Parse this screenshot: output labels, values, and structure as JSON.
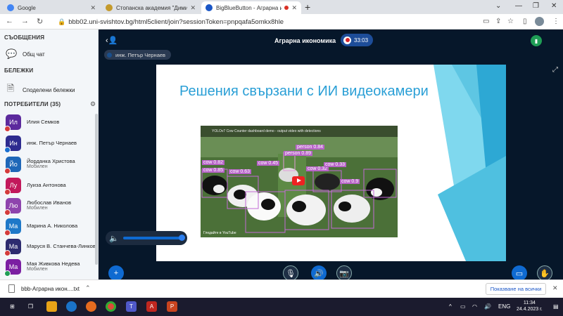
{
  "browser": {
    "tabs": [
      {
        "title": "Google",
        "active": false,
        "favicon_color": "#4285f4"
      },
      {
        "title": "Стопанска академия \"Димитър",
        "active": false,
        "favicon_color": "#c49a2c"
      },
      {
        "title": "BigBlueButton - Аграрна ик",
        "active": true,
        "favicon_color": "#1a56c6"
      }
    ],
    "new_tab": "+",
    "url": "bbb02.uni-svishtov.bg/html5client/join?sessionToken=pnpqafa5omkx8hle"
  },
  "sidebar": {
    "messages_title": "СЪОБЩЕНИЯ",
    "public_chat": "Общ чат",
    "notes_title": "БЕЛЕЖКИ",
    "shared_notes": "Споделени бележки",
    "users_title": "ПОТРЕБИТЕЛИ (35)",
    "users": [
      {
        "initials": "Ил",
        "name": "Илия Семков",
        "sub": "",
        "color": "#5c2a9d",
        "badge": "#d33b3b"
      },
      {
        "initials": "Ин",
        "name": "инж. Петър Чернаев",
        "sub": "",
        "color": "#2d2b8f",
        "badge": "#1a6fd0"
      },
      {
        "initials": "Йо",
        "name": "Йорданка Христова",
        "sub": "Мобилен",
        "color": "#1e67b8",
        "badge": "#d33b3b"
      },
      {
        "initials": "Лу",
        "name": "Луиза Антонова",
        "sub": "",
        "color": "#c2185b",
        "badge": "#d33b3b"
      },
      {
        "initials": "Лю",
        "name": "Любослав Иванов",
        "sub": "Мобилен",
        "color": "#8e44ad",
        "badge": "#d33b3b"
      },
      {
        "initials": "Ма",
        "name": "Марина А. Николова",
        "sub": "",
        "color": "#1e78c8",
        "badge": "#d33b3b"
      },
      {
        "initials": "Ма",
        "name": "Маруся В. Станчева-Линкова",
        "sub": "",
        "color": "#2d2b6f",
        "badge": "#d33b3b"
      },
      {
        "initials": "Ма",
        "name": "Мая Живкова Недева",
        "sub": "Мобилен",
        "color": "#7b1fa2",
        "badge": "#1f9d55"
      }
    ]
  },
  "meeting": {
    "title": "Аграрна икономика",
    "timer": "33:03",
    "talker": "инж. Петър Чернаев"
  },
  "slide": {
    "title": "Решения свързани с ИИ видеокамери",
    "video_title": "YOLOv7 Cow Counter dashboard demo - output video with detections",
    "video_footer": "Гледайте в YouTube",
    "detections": [
      {
        "label": "person",
        "confidence": 0.84
      },
      {
        "label": "person",
        "confidence": 0.89
      },
      {
        "label": "cow",
        "confidence": 0.82
      },
      {
        "label": "cow",
        "confidence": 0.85
      },
      {
        "label": "cow",
        "confidence": 0.45
      },
      {
        "label": "cow",
        "confidence": 0.63
      },
      {
        "label": "cow",
        "confidence": 0.32
      },
      {
        "label": "cow",
        "confidence": 0.33
      },
      {
        "label": "cow",
        "confidence": 0.9
      }
    ]
  },
  "downloads": {
    "file": "bbb-Аграрна икон....txt",
    "show_all": "Показване на всички"
  },
  "taskbar": {
    "language": "ENG",
    "time": "11:34",
    "date": "24.4.2023 г."
  }
}
